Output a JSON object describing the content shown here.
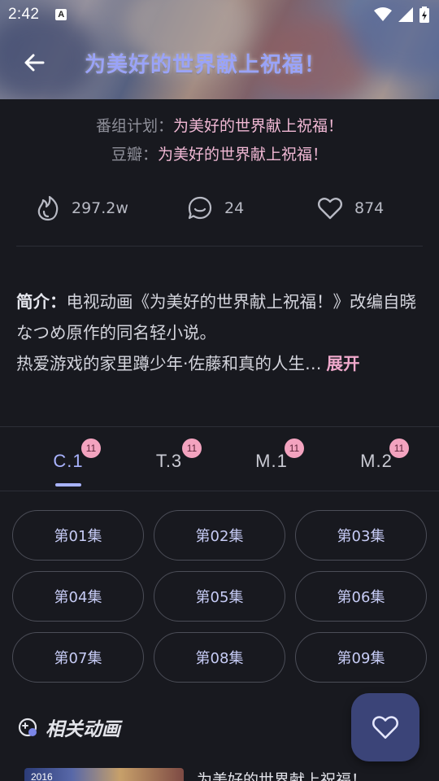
{
  "status_bar": {
    "time": "2:42",
    "notification_letter": "A"
  },
  "app_bar": {
    "title": "为美好的世界献上祝福！"
  },
  "meta": {
    "plan_label": "番组计划：",
    "plan_value": "为美好的世界献上祝福！",
    "douban_label": "豆瓣：",
    "douban_value": "为美好的世界献上祝福！"
  },
  "stats": {
    "hot": "297.2w",
    "comments": "24",
    "likes": "874"
  },
  "intro": {
    "label": "简介：",
    "line1": "电视动画《为美好的世界献上祝福！》改编自晓なつめ原作的同名轻小说。",
    "line2": "热爱游戏的家里蹲少年·佐藤和真的人生…",
    "expand": "展开"
  },
  "tabs": [
    {
      "label": "C.1",
      "badge": "11",
      "active": true
    },
    {
      "label": "T.3",
      "badge": "11",
      "active": false
    },
    {
      "label": "M.1",
      "badge": "11",
      "active": false
    },
    {
      "label": "M.2",
      "badge": "11",
      "active": false
    }
  ],
  "episodes": [
    "第01集",
    "第02集",
    "第03集",
    "第04集",
    "第05集",
    "第06集",
    "第07集",
    "第08集",
    "第09集"
  ],
  "related": {
    "title": "相关动画",
    "item_year": "2016",
    "item_name": "为美好的世界献上祝福！"
  },
  "colors": {
    "accent": "#a9b3ff",
    "pink": "#f0a9cc",
    "background": "#18191f",
    "fab": "#3b4478"
  }
}
